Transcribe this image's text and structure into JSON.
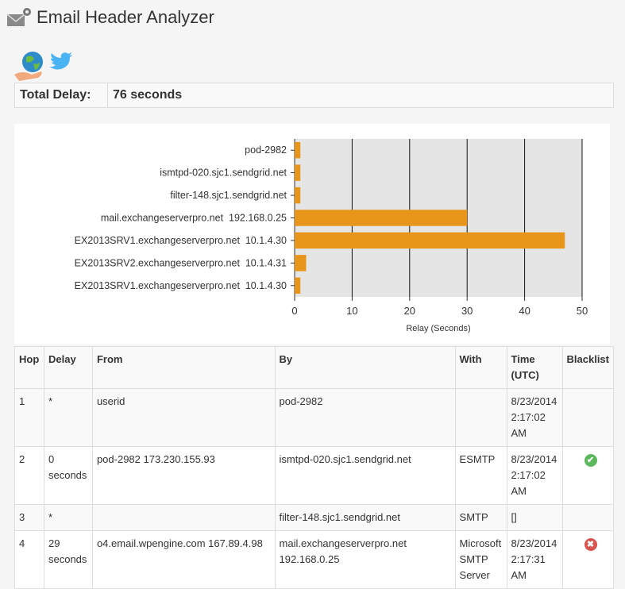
{
  "header": {
    "title": "Email Header Analyzer",
    "icon": "envelope-gear-icon"
  },
  "social": {
    "globe_icon": "globe-hand-icon",
    "twitter_icon": "twitter-bird-icon"
  },
  "summary": {
    "total_delay_label": "Total Delay:",
    "total_delay_value": "76 seconds"
  },
  "chart_data": {
    "type": "bar",
    "orientation": "horizontal",
    "categories": [
      "pod-2982",
      "ismtpd-020.sjc1.sendgrid.net",
      "filter-148.sjc1.sendgrid.net",
      "mail.exchangeserverpro.net  192.168.0.25",
      "EX2013SRV1.exchangeserverpro.net  10.1.4.30",
      "EX2013SRV2.exchangeserverpro.net  10.1.4.31",
      "EX2013SRV1.exchangeserverpro.net  10.1.4.30"
    ],
    "values": [
      1,
      1,
      1,
      30,
      47,
      2,
      1
    ],
    "xlabel": "Relay (Seconds)",
    "xlim": [
      0,
      50
    ],
    "xticks": [
      0,
      10,
      20,
      30,
      40,
      50
    ],
    "grid": true,
    "bar_color": "#e8951c",
    "plot_bg": "#e5e5e5"
  },
  "table": {
    "headers": [
      "Hop",
      "Delay",
      "From",
      "By",
      "With",
      "Time (UTC)",
      "Blacklist"
    ],
    "rows": [
      {
        "hop": "1",
        "delay": "*",
        "from": "userid",
        "by": "pod-2982",
        "with": "",
        "time": "8/23/2014 2:17:02 AM",
        "blacklist": ""
      },
      {
        "hop": "2",
        "delay": "0 seconds",
        "from": "pod-2982 173.230.155.93",
        "by": "ismtpd-020.sjc1.sendgrid.net",
        "with": "ESMTP",
        "time": "8/23/2014 2:17:02 AM",
        "blacklist": "ok"
      },
      {
        "hop": "3",
        "delay": "*",
        "from": "",
        "by": "filter-148.sjc1.sendgrid.net",
        "with": "SMTP",
        "time": "[]",
        "blacklist": ""
      },
      {
        "hop": "4",
        "delay": "29 seconds",
        "from": "o4.email.wpengine.com 167.89.4.98",
        "by": "mail.exchangeserverpro.net 192.168.0.25",
        "with": "Microsoft SMTP Server",
        "time": "8/23/2014 2:17:31 AM",
        "blacklist": "listed"
      }
    ]
  },
  "colors": {
    "ok": "#5cb85c",
    "listed": "#d9534f"
  }
}
